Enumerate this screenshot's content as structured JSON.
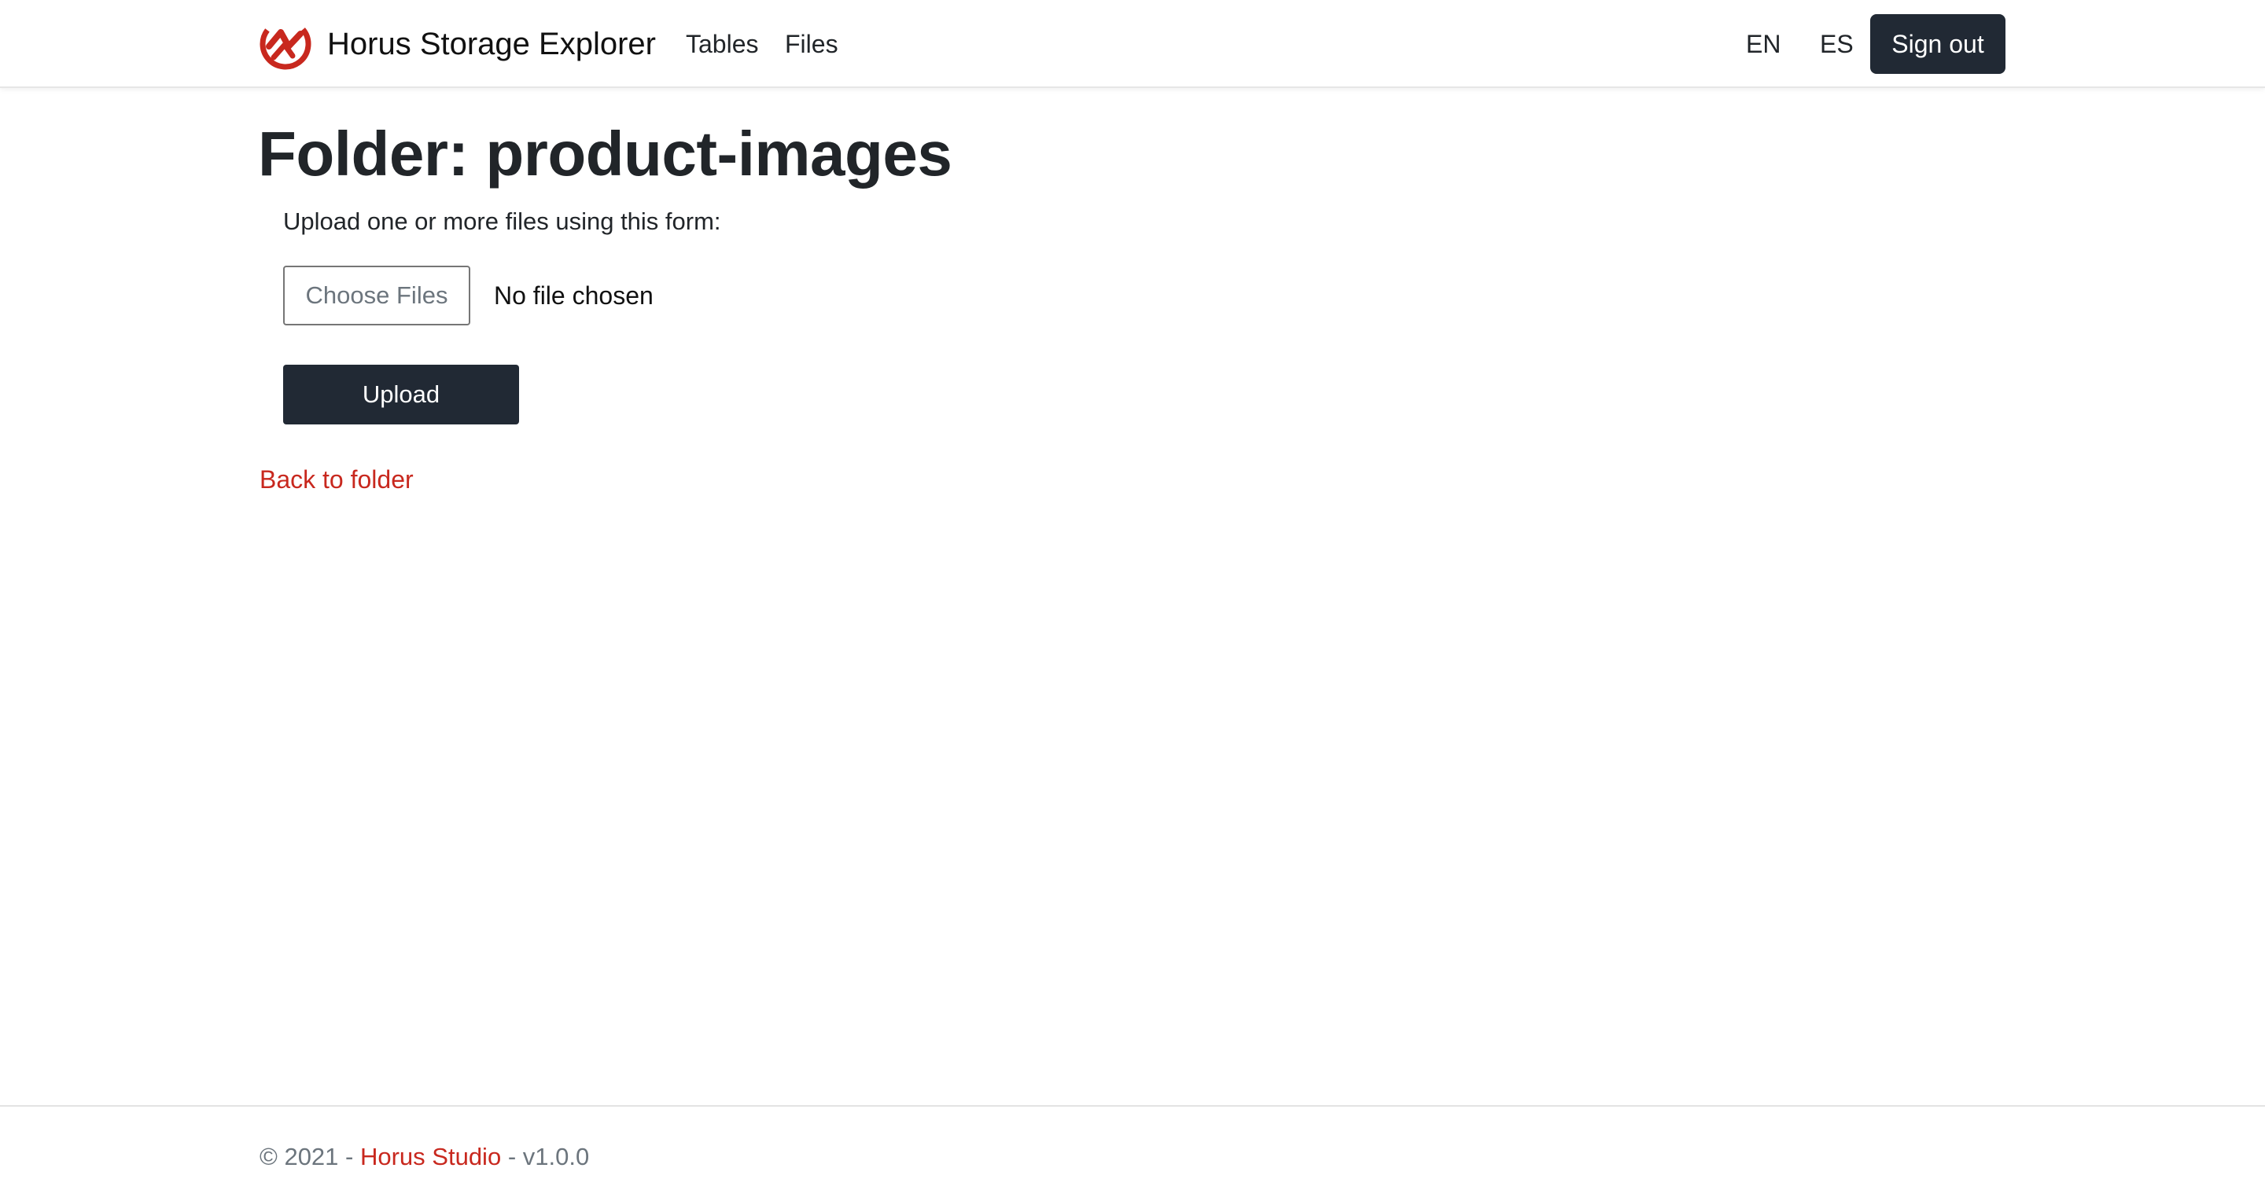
{
  "navbar": {
    "brand": "Horus Storage Explorer",
    "links": [
      "Tables",
      "Files"
    ],
    "languages": [
      "EN",
      "ES"
    ],
    "sign_out": "Sign out"
  },
  "main": {
    "title": "Folder: product-images",
    "help_text": "Upload one or more files using this form:",
    "file_input": {
      "button_label": "Choose Files",
      "status": "No file chosen"
    },
    "upload_button": "Upload",
    "back_link": "Back to folder"
  },
  "footer": {
    "copyright": "© 2021 -",
    "studio_link": "Horus Studio",
    "version": "- v1.0.0"
  },
  "colors": {
    "brand_red": "#c8281e",
    "dark_button": "#212934"
  },
  "icons": {
    "logo": "horus-logo-icon"
  }
}
